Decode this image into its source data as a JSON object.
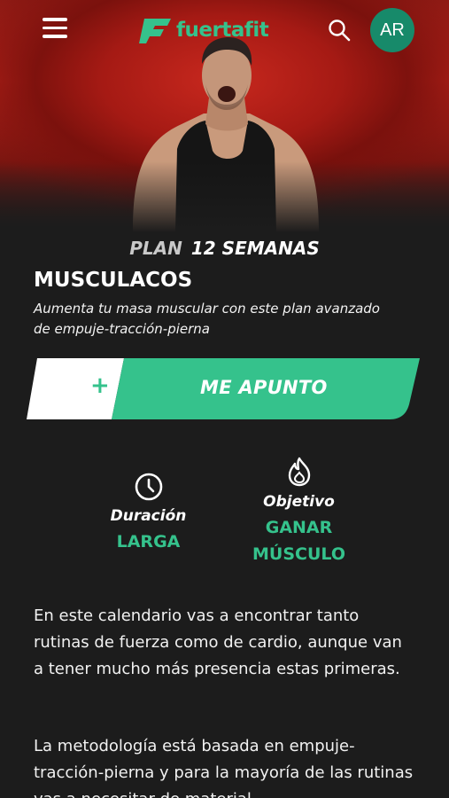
{
  "header": {
    "logo_text": "fuertafit",
    "avatar_initials": "AR",
    "brand_color": "#35c28c",
    "icons": [
      "menu-icon",
      "search-icon"
    ]
  },
  "plan": {
    "prefix": "PLAN",
    "duration_label": "12 SEMANAS",
    "title": "MUSCULACOS",
    "description": "Aumenta tu masa muscular con este plan avanzado de empuje-tracción-pierna"
  },
  "cta": {
    "plus": "+",
    "label": "ME APUNTO"
  },
  "stats": {
    "duration": {
      "label": "Duración",
      "value": "LARGA",
      "icon": "clock-icon"
    },
    "goal": {
      "label": "Objetivo",
      "value_line1": "GANAR",
      "value_line2": "MÚSCULO",
      "icon": "flame-icon"
    }
  },
  "content": {
    "paragraph1": "En este calendario vas a encontrar tanto rutinas de fuerza como de cardio, aunque van a tener mucho más presencia estas primeras.",
    "paragraph2": "La metodología está basada en empuje-tracción-pierna y para la mayoría de las rutinas vas a necesitar de material."
  }
}
